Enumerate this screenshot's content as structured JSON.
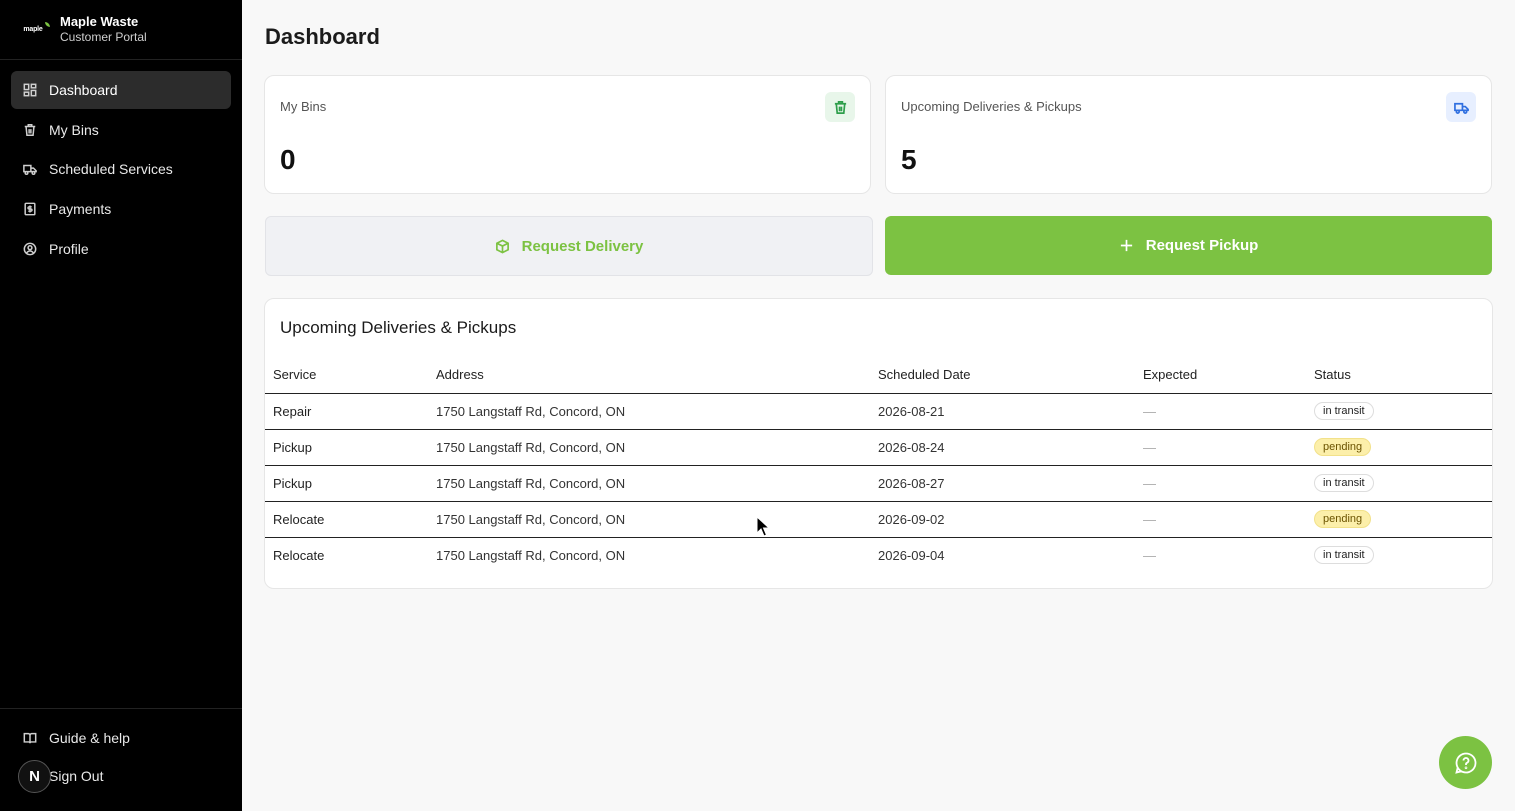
{
  "brand": {
    "logo_text": "maple",
    "name": "Maple Waste",
    "subtitle": "Customer Portal"
  },
  "sidebar": {
    "items": [
      {
        "label": "Dashboard",
        "icon": "dashboard-icon",
        "active": true
      },
      {
        "label": "My Bins",
        "icon": "trash-icon"
      },
      {
        "label": "Scheduled Services",
        "icon": "truck-icon"
      },
      {
        "label": "Payments",
        "icon": "receipt-icon"
      },
      {
        "label": "Profile",
        "icon": "user-circle-icon"
      }
    ],
    "bottom": [
      {
        "label": "Guide & help",
        "icon": "book-icon"
      },
      {
        "label": "Sign Out",
        "icon": "n-avatar",
        "avatar_letter": "N"
      }
    ]
  },
  "main": {
    "title": "Dashboard",
    "cards": [
      {
        "label": "My Bins",
        "value": "0",
        "icon": "trash-icon",
        "icon_color": "#2e9e4b",
        "icon_bg": "#e8f6ea"
      },
      {
        "label": "Upcoming Deliveries & Pickups",
        "value": "5",
        "icon": "truck-icon",
        "icon_color": "#2f6fe0",
        "icon_bg": "#e7efff"
      }
    ],
    "actions": {
      "request_delivery": "Request Delivery",
      "request_pickup": "Request Pickup"
    },
    "table": {
      "title": "Upcoming Deliveries & Pickups",
      "columns": [
        "Service",
        "Address",
        "Scheduled Date",
        "Expected",
        "Status"
      ],
      "rows": [
        {
          "service": "Repair",
          "address": "1750 Langstaff Rd, Concord, ON",
          "date": "2026-08-21",
          "expected": "—",
          "status": "in transit"
        },
        {
          "service": "Pickup",
          "address": "1750 Langstaff Rd, Concord, ON",
          "date": "2026-08-24",
          "expected": "—",
          "status": "pending"
        },
        {
          "service": "Pickup",
          "address": "1750 Langstaff Rd, Concord, ON",
          "date": "2026-08-27",
          "expected": "—",
          "status": "in transit"
        },
        {
          "service": "Relocate",
          "address": "1750 Langstaff Rd, Concord, ON",
          "date": "2026-09-02",
          "expected": "—",
          "status": "pending"
        },
        {
          "service": "Relocate",
          "address": "1750 Langstaff Rd, Concord, ON",
          "date": "2026-09-04",
          "expected": "—",
          "status": "in transit"
        }
      ]
    }
  },
  "colors": {
    "accent": "#7cc242",
    "sidebar_bg": "#000000",
    "page_bg": "#f8f8f8"
  }
}
